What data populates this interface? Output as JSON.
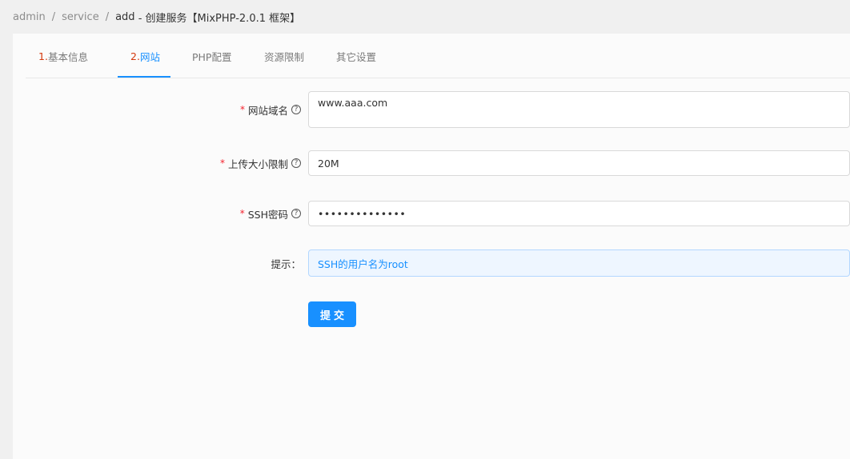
{
  "breadcrumb": {
    "items": [
      "admin",
      "service",
      "add"
    ],
    "separator": "/",
    "current_suffix": " - 创建服务【MixPHP-2.0.1 框架】"
  },
  "tabs": [
    {
      "num": "1.",
      "label": "基本信息",
      "active": false
    },
    {
      "num": "2.",
      "label": "网站",
      "active": true
    },
    {
      "num": "",
      "label": "PHP配置",
      "active": false
    },
    {
      "num": "",
      "label": "资源限制",
      "active": false
    },
    {
      "num": "",
      "label": "其它设置",
      "active": false
    }
  ],
  "form": {
    "domain": {
      "label": "网站域名",
      "required": true,
      "value": "www.aaa.com"
    },
    "upload_limit": {
      "label": "上传大小限制",
      "required": true,
      "value": "20M"
    },
    "ssh_password": {
      "label": "SSH密码",
      "required": true,
      "value": "••••••••••••••"
    },
    "hint": {
      "label": "提示：",
      "text": "SSH的用户名为root"
    },
    "submit_label": "提交"
  },
  "colors": {
    "primary": "#1890ff",
    "required": "#f5222d",
    "step_number": "#d4380d"
  }
}
